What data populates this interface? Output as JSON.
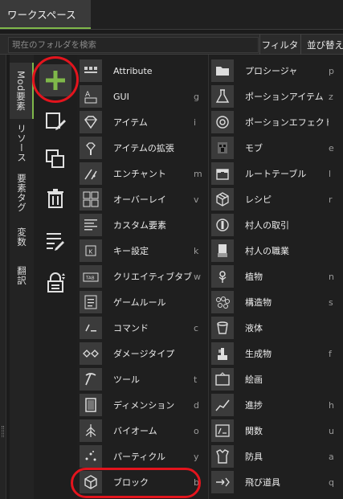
{
  "workspace_tab": "ワークスペース",
  "search": {
    "placeholder": "現在のフォルダを検索"
  },
  "toolbar": {
    "filter_label": "フィルタ",
    "sort_label": "並び替え"
  },
  "vertical_tabs": [
    {
      "label": "Mod要素",
      "active": true
    },
    {
      "label": "リソース",
      "active": false
    },
    {
      "label": "要素タグ",
      "active": false
    },
    {
      "label": "変数",
      "active": false
    },
    {
      "label": "翻訳",
      "active": false
    }
  ],
  "tools": [
    {
      "name": "add-element-button",
      "icon": "plus-icon"
    },
    {
      "name": "edit-element-button",
      "icon": "edit-icon"
    },
    {
      "name": "duplicate-element-button",
      "icon": "duplicate-icon"
    },
    {
      "name": "delete-element-button",
      "icon": "trash-icon"
    },
    {
      "name": "edit-list-button",
      "icon": "list-edit-icon"
    },
    {
      "name": "lock-element-button",
      "icon": "lock-icon"
    }
  ],
  "elements_left": [
    {
      "label": "Attribute",
      "key": "",
      "icon": "attribute-icon"
    },
    {
      "label": "GUI",
      "key": "g",
      "icon": "gui-icon"
    },
    {
      "label": "アイテム",
      "key": "i",
      "icon": "gem-icon"
    },
    {
      "label": "アイテムの拡張",
      "key": "",
      "icon": "item-extension-icon"
    },
    {
      "label": "エンチャント",
      "key": "m",
      "icon": "enchant-icon"
    },
    {
      "label": "オーバーレイ",
      "key": "v",
      "icon": "overlay-icon"
    },
    {
      "label": "カスタム要素",
      "key": "",
      "icon": "custom-element-icon"
    },
    {
      "label": "キー設定",
      "key": "k",
      "icon": "keybind-icon"
    },
    {
      "label": "クリエイティブタブ",
      "key": "w",
      "icon": "creative-tab-icon"
    },
    {
      "label": "ゲームルール",
      "key": "",
      "icon": "gamerule-icon"
    },
    {
      "label": "コマンド",
      "key": "c",
      "icon": "command-icon"
    },
    {
      "label": "ダメージタイプ",
      "key": "",
      "icon": "damage-type-icon"
    },
    {
      "label": "ツール",
      "key": "t",
      "icon": "pickaxe-icon"
    },
    {
      "label": "ディメンション",
      "key": "d",
      "icon": "dimension-icon"
    },
    {
      "label": "バイオーム",
      "key": "o",
      "icon": "biome-icon"
    },
    {
      "label": "パーティクル",
      "key": "y",
      "icon": "particle-icon"
    },
    {
      "label": "ブロック",
      "key": "b",
      "icon": "cube-icon"
    }
  ],
  "elements_right": [
    {
      "label": "プロシージャ",
      "key": "p",
      "icon": "folder-icon"
    },
    {
      "label": "ポーションアイテム",
      "key": "z",
      "icon": "flask-icon"
    },
    {
      "label": "ポーションエフェクト",
      "key": "",
      "icon": "potion-effect-icon"
    },
    {
      "label": "モブ",
      "key": "e",
      "icon": "mob-icon"
    },
    {
      "label": "ルートテーブル",
      "key": "l",
      "icon": "loot-table-icon"
    },
    {
      "label": "レシピ",
      "key": "r",
      "icon": "recipe-icon"
    },
    {
      "label": "村人の取引",
      "key": "",
      "icon": "villager-trade-icon"
    },
    {
      "label": "村人の職業",
      "key": "",
      "icon": "villager-profession-icon"
    },
    {
      "label": "植物",
      "key": "n",
      "icon": "plant-icon"
    },
    {
      "label": "構造物",
      "key": "s",
      "icon": "structure-icon"
    },
    {
      "label": "液体",
      "key": "",
      "icon": "bucket-icon"
    },
    {
      "label": "生成物",
      "key": "f",
      "icon": "feature-icon"
    },
    {
      "label": "絵画",
      "key": "",
      "icon": "painting-icon"
    },
    {
      "label": "進捗",
      "key": "h",
      "icon": "advancement-icon"
    },
    {
      "label": "関数",
      "key": "u",
      "icon": "function-icon"
    },
    {
      "label": "防具",
      "key": "a",
      "icon": "armor-icon"
    },
    {
      "label": "飛び道具",
      "key": "q",
      "icon": "projectile-icon"
    }
  ],
  "colors": {
    "accent": "#7fb84a",
    "highlight": "#e3141d",
    "background": "#1f1f1f"
  }
}
